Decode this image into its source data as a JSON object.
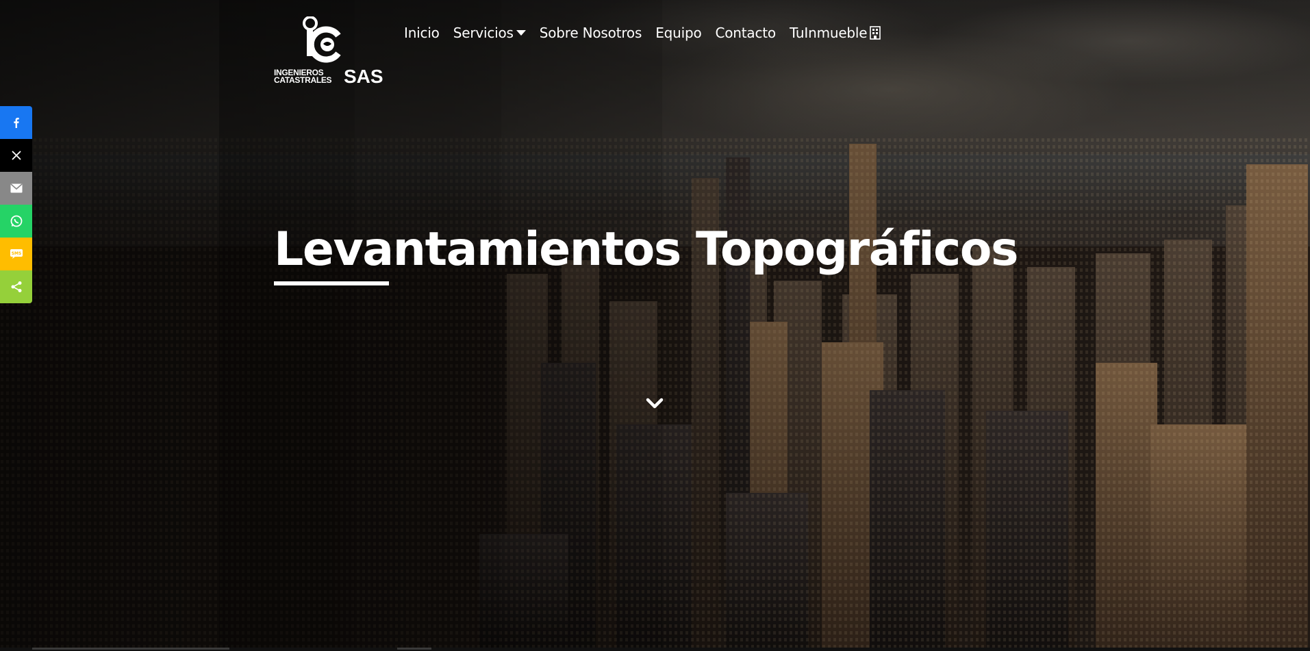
{
  "brand": {
    "logo_line1": "INGENIEROS",
    "logo_line2": "CATASTRALES",
    "logo_suffix": "SAS"
  },
  "nav": {
    "items": [
      {
        "label": "Inicio"
      },
      {
        "label": "Servicios",
        "has_dropdown": true
      },
      {
        "label": "Sobre Nosotros"
      },
      {
        "label": "Equipo"
      },
      {
        "label": "Contacto"
      },
      {
        "label": "TuInmueble",
        "icon": "building-icon"
      }
    ]
  },
  "hero": {
    "title": "Levantamientos Topográficos",
    "scroll_icon": "chevron-down-icon"
  },
  "social": [
    {
      "name": "facebook",
      "icon": "facebook-icon",
      "color": "#1877f2"
    },
    {
      "name": "x",
      "icon": "x-icon",
      "color": "#000000"
    },
    {
      "name": "email",
      "icon": "email-icon",
      "color": "#888888"
    },
    {
      "name": "whatsapp",
      "icon": "whatsapp-icon",
      "color": "#25d366"
    },
    {
      "name": "sms",
      "icon": "sms-icon",
      "color": "#ffbd00"
    },
    {
      "name": "share",
      "icon": "share-icon",
      "color": "#95d03a"
    }
  ]
}
